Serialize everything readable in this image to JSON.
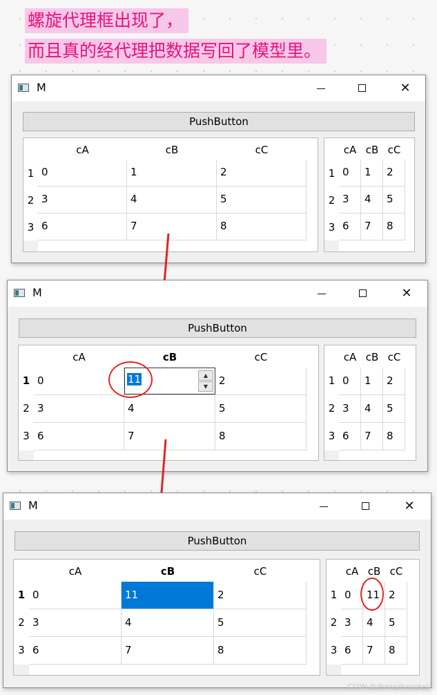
{
  "annotation": {
    "line1": "螺旋代理框出现了，",
    "line2": "而且真的经代理把数据写回了模型里。"
  },
  "window": {
    "title": "M",
    "minimize_icon": "minimize-icon",
    "maximize_icon": "maximize-icon",
    "close_icon": "close-icon",
    "close_glyph": "✕"
  },
  "push_button_label": "PushButton",
  "columns": [
    "cA",
    "cB",
    "cC"
  ],
  "rows": [
    "1",
    "2",
    "3"
  ],
  "states": [
    {
      "cells": [
        [
          "0",
          "1",
          "2"
        ],
        [
          "3",
          "4",
          "5"
        ],
        [
          "6",
          "7",
          "8"
        ]
      ],
      "right_cells": [
        [
          "0",
          "1",
          "2"
        ],
        [
          "3",
          "4",
          "5"
        ],
        [
          "6",
          "7",
          "8"
        ]
      ],
      "current_column": null,
      "current_row": null
    },
    {
      "cells": [
        [
          "0",
          "",
          "2"
        ],
        [
          "3",
          "4",
          "5"
        ],
        [
          "6",
          "7",
          "8"
        ]
      ],
      "editor_value": "11",
      "spin_up": "▲",
      "spin_down": "▼",
      "right_cells": [
        [
          "0",
          "1",
          "2"
        ],
        [
          "3",
          "4",
          "5"
        ],
        [
          "6",
          "7",
          "8"
        ]
      ],
      "current_column": "cB",
      "current_row": "1"
    },
    {
      "cells": [
        [
          "0",
          "11",
          "2"
        ],
        [
          "3",
          "4",
          "5"
        ],
        [
          "6",
          "7",
          "8"
        ]
      ],
      "selected_value": "11",
      "right_cells": [
        [
          "0",
          "11",
          "2"
        ],
        [
          "3",
          "4",
          "5"
        ],
        [
          "6",
          "7",
          "8"
        ]
      ],
      "current_column": "cB",
      "current_row": "1"
    }
  ],
  "colors": {
    "annotation_text": "#e8127c",
    "annotation_bg": "#f7c8e8",
    "selection": "#0078d7",
    "highlight_ring": "#e52222"
  },
  "watermark": "CSDN @zhangzhangkeji"
}
